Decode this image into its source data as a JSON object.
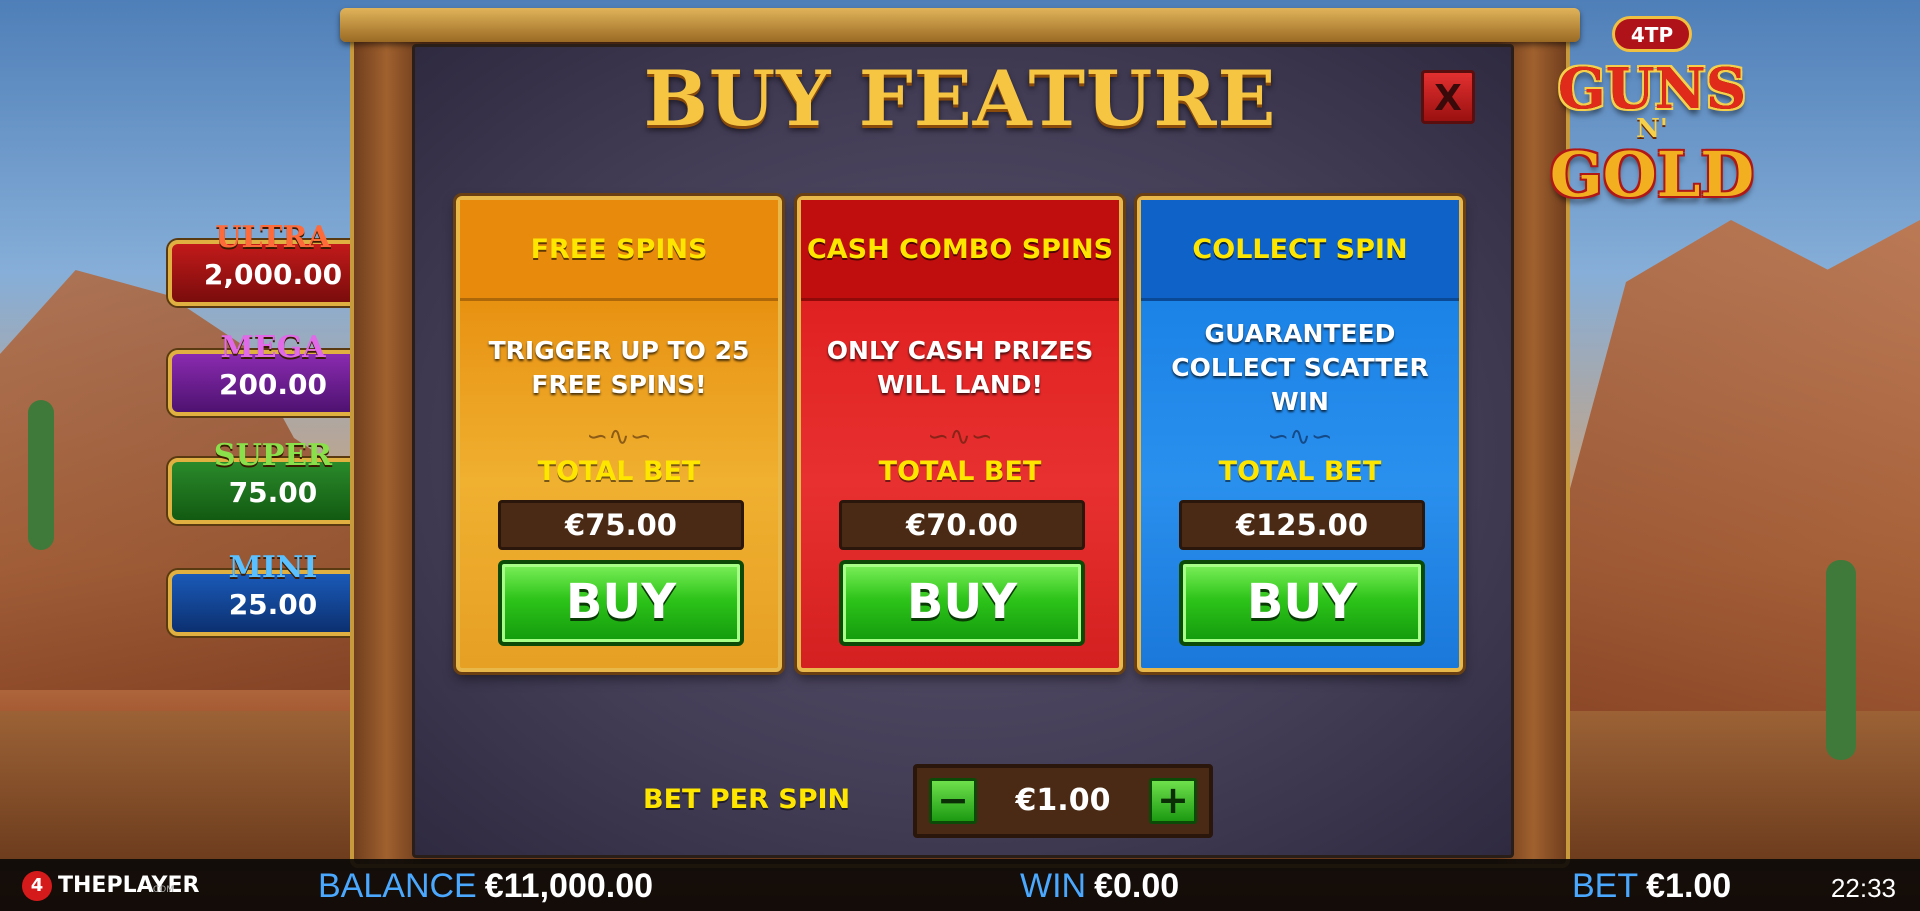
{
  "title": "BUY FEATURE",
  "close_label": "X",
  "cards": [
    {
      "heading": "FREE SPINS",
      "description": "TRIGGER UP TO 25 FREE SPINS!",
      "total_label": "TOTAL BET",
      "price": "€75.00",
      "buy_label": "BUY",
      "color": "#f0a020"
    },
    {
      "heading": "CASH COMBO SPINS",
      "description": "ONLY CASH PRIZES WILL LAND!",
      "total_label": "TOTAL BET",
      "price": "€70.00",
      "buy_label": "BUY",
      "color": "#e02020"
    },
    {
      "heading": "COLLECT SPIN",
      "description": "GUARANTEED COLLECT SCATTER WIN",
      "total_label": "TOTAL BET",
      "price": "€125.00",
      "buy_label": "BUY",
      "color": "#1a82e6"
    }
  ],
  "bet_per_spin": {
    "label": "BET PER SPIN",
    "value": "€1.00",
    "minus": "−",
    "plus": "+"
  },
  "jackpots": [
    {
      "name": "ULTRA",
      "value": "2,000.00"
    },
    {
      "name": "MEGA",
      "value": "200.00"
    },
    {
      "name": "SUPER",
      "value": "75.00"
    },
    {
      "name": "MINI",
      "value": "25.00"
    }
  ],
  "logo": {
    "badge": "4TP",
    "line1": "GUNS",
    "line2": "N'",
    "line3": "GOLD"
  },
  "bottom_bar": {
    "brand_mark": "4",
    "brand": "THEPLAYER",
    "brand_sub": ".COM",
    "balance_label": "BALANCE",
    "balance": "€11,000.00",
    "win_label": "WIN",
    "win": "€0.00",
    "bet_label": "BET",
    "bet": "€1.00",
    "clock": "22:33"
  },
  "icons": {
    "close": "close-icon",
    "swirl": "swirl-ornament-icon",
    "minus": "minus-icon",
    "plus": "plus-icon"
  }
}
